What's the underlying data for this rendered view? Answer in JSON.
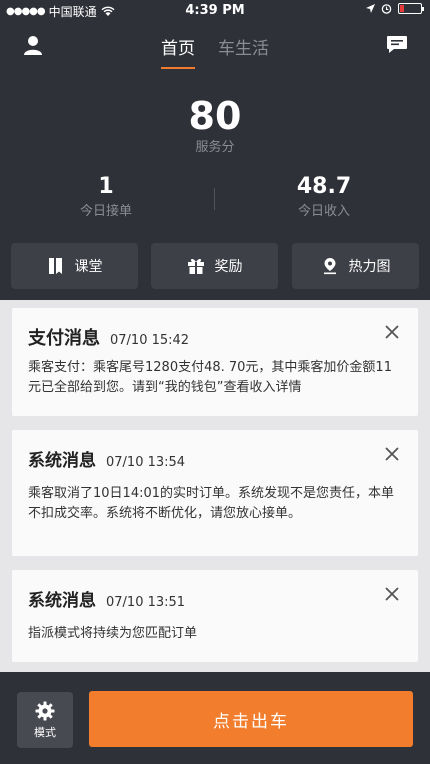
{
  "status_bar": {
    "carrier": "中国联通",
    "time": "4:39 PM"
  },
  "nav": {
    "tabs": [
      {
        "label": "首页",
        "active": true
      },
      {
        "label": "车生活",
        "active": false
      }
    ]
  },
  "score": {
    "value": "80",
    "label": "服务分"
  },
  "stats": {
    "orders_value": "1",
    "orders_label": "今日接单",
    "income_value": "48.7",
    "income_label": "今日收入"
  },
  "quick_actions": [
    {
      "label": "课堂",
      "icon": "book-icon"
    },
    {
      "label": "奖励",
      "icon": "gift-icon"
    },
    {
      "label": "热力图",
      "icon": "location-pin-icon"
    }
  ],
  "messages": [
    {
      "title": "支付消息",
      "time": "07/10 15:42",
      "body": "乘客支付：乘客尾号1280支付48. 70元，其中乘客加价金额11元已全部给到您。请到“我的钱包”查看收入详情"
    },
    {
      "title": "系统消息",
      "time": "07/10 13:54",
      "body": "乘客取消了10日14:01的实时订单。系统发现不是您责任，本单不扣成交率。系统将不断优化，请您放心接单。"
    },
    {
      "title": "系统消息",
      "time": "07/10 13:51",
      "body": "指派模式将持续为您匹配订单"
    }
  ],
  "bottom": {
    "mode_label": "模式",
    "go_label": "点击出车"
  },
  "colors": {
    "accent": "#f27d2c",
    "header_bg": "#2f3138",
    "feed_bg": "#e6e6e8"
  }
}
